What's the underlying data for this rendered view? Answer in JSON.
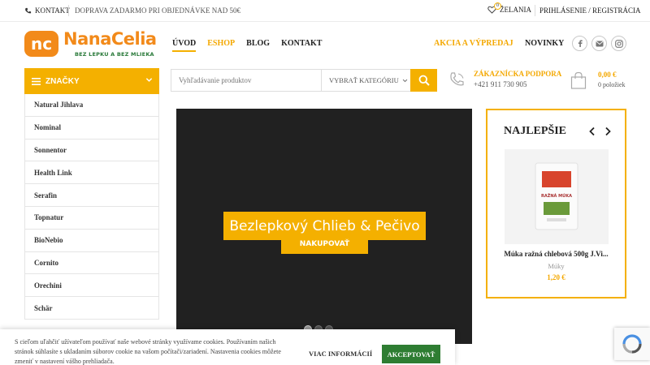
{
  "topbar": {
    "contact": "KONTAKT",
    "shipping": "DOPRAVA ZADARMO PRI OBJEDNÁVKE NAD 50€",
    "wishlist": "ŽELANIA",
    "wishlist_count": "0",
    "login": "PRIHLÁSENIE / REGISTRÁCIA"
  },
  "logo": {
    "name": "NanaCelia",
    "mark": "nc",
    "tagline": "BEZ LEPKU A BEZ MLIEKA"
  },
  "nav": {
    "items": [
      "ÚVOD",
      "ESHOP",
      "BLOG",
      "KONTAKT"
    ]
  },
  "promo": "AKCIA A VÝPREDAJ",
  "news": "NOVINKY",
  "social": [
    "facebook-icon",
    "mail-icon",
    "instagram-icon"
  ],
  "brands": {
    "title": "ZNAČKY",
    "items": [
      "Natural Jihlava",
      "Nominal",
      "Sonnentor",
      "Health Link",
      "Serafin",
      "Topnatur",
      "BioNebio",
      "Cornito",
      "Orechini",
      "Schär"
    ]
  },
  "search": {
    "placeholder": "Vyhľadávanie produktov",
    "category": "VYBRAŤ KATEGÓRIU"
  },
  "support": {
    "title": "ZÁKAZNÍCKA PODPORA",
    "phone": "+421 911 730 905"
  },
  "cart": {
    "total": "0,00 €",
    "count": "0 položiek"
  },
  "hero": {
    "title": "Bezlepkový Chlieb & Pečivo",
    "button": "NAKUPOVAŤ",
    "slides": 3,
    "active_slide": 0
  },
  "best": {
    "title": "NAJLEPŠIE",
    "product": {
      "name": "Múka ražná chlebová 500g J.Vi...",
      "category": "Múky",
      "price": "1,20 €",
      "package_label": "RAŽNÁ MÚKA"
    }
  },
  "cookie": {
    "text": "S cieľom uľahčiť užívateľom používať naše webové stránky využívame cookies. Používaním našich stránok súhlasíte s ukladaním súborov cookie na vašom počítači/zariadení. Nastavenia cookies môžete zmeniť v nastavení vášho prehliadača.",
    "more": "VIAC INFORMÁCIÍ",
    "accept": "AKCEPTOVAŤ"
  },
  "colors": {
    "accent": "#f4b000",
    "accent_text": "#f4a800",
    "dark": "#212121",
    "green": "#2e7d32",
    "logo_orange": "#f28a1a"
  }
}
